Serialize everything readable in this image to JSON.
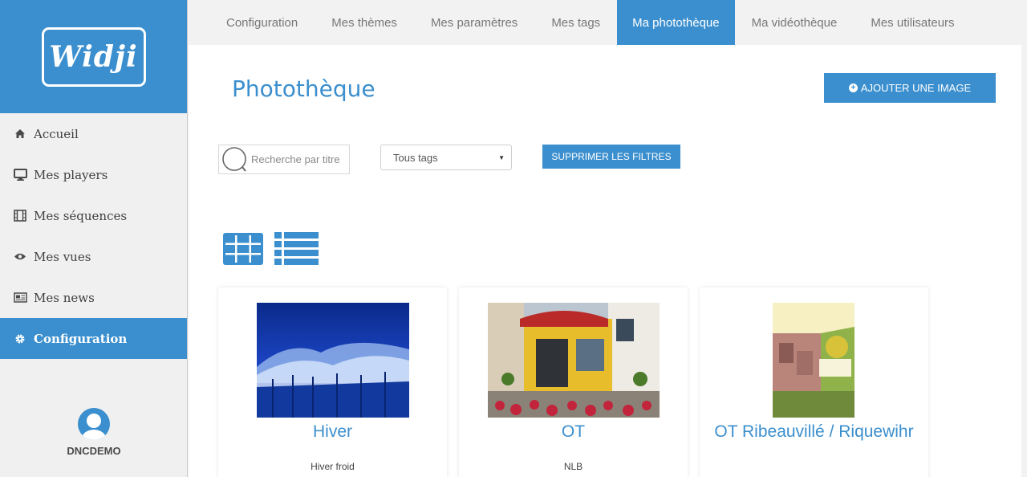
{
  "logo": {
    "text": "Widji"
  },
  "sidebar": {
    "items": [
      {
        "label": "Accueil",
        "icon": "home-icon"
      },
      {
        "label": "Mes players",
        "icon": "monitor-icon"
      },
      {
        "label": "Mes séquences",
        "icon": "film-icon"
      },
      {
        "label": "Mes vues",
        "icon": "eye-icon"
      },
      {
        "label": "Mes news",
        "icon": "newspaper-icon"
      },
      {
        "label": "Configuration",
        "icon": "gear-icon",
        "active": true
      }
    ],
    "user": {
      "name": "DNCDEMO"
    }
  },
  "topnav": {
    "tabs": [
      {
        "label": "Configuration"
      },
      {
        "label": "Mes thèmes"
      },
      {
        "label": "Mes paramètres"
      },
      {
        "label": "Mes tags"
      },
      {
        "label": "Ma photothèque",
        "active": true
      },
      {
        "label": "Ma vidéothèque"
      },
      {
        "label": "Mes utilisateurs"
      }
    ]
  },
  "main": {
    "title": "Photothèque",
    "add_button": "AJOUTER UNE IMAGE",
    "search_placeholder": "Recherche par titre",
    "tag_filter": "Tous tags",
    "clear_filters": "SUPPRIMER LES FILTRES",
    "cards": [
      {
        "title": "Hiver",
        "description": "Hiver froid"
      },
      {
        "title": "OT",
        "description": "NLB"
      },
      {
        "title": "OT Ribeauvillé / Riquewihr",
        "description": ""
      }
    ]
  },
  "colors": {
    "accent": "#3b8fce",
    "sidebar_bg": "#f0f0f0",
    "topbar_bg": "#f2f2f2"
  }
}
